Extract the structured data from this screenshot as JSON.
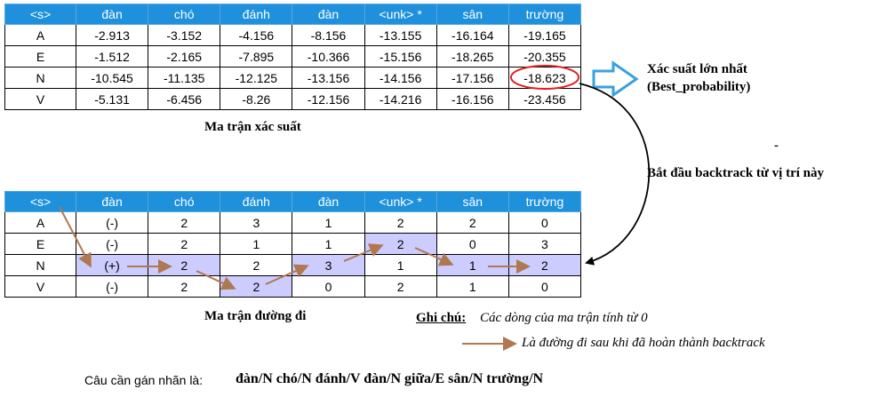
{
  "prob_matrix": {
    "headers": [
      "<s>",
      "đàn",
      "chó",
      "đánh",
      "đàn",
      "<unk> *",
      "sân",
      "trường"
    ],
    "rows": [
      [
        "A",
        "-2.913",
        "-3.152",
        "-4.156",
        "-8.156",
        "-13.155",
        "-16.164",
        "-19.165"
      ],
      [
        "E",
        "-1.512",
        "-2.165",
        "-7.895",
        "-10.366",
        "-15.156",
        "-18.265",
        "-20.355"
      ],
      [
        "N",
        "-10.545",
        "-11.135",
        "-12.125",
        "-13.156",
        "-14.156",
        "-17.156",
        "-18.623"
      ],
      [
        "V",
        "-5.131",
        "-6.456",
        "-8.26",
        "-12.156",
        "-14.216",
        "-16.156",
        "-23.456"
      ]
    ],
    "caption": "Ma trận xác suất"
  },
  "path_matrix": {
    "headers": [
      "<s>",
      "đàn",
      "chó",
      "đánh",
      "đàn",
      "<unk> *",
      "sân",
      "trường"
    ],
    "rows": [
      [
        "A",
        "(-)",
        "2",
        "3",
        "1",
        "2",
        "2",
        "0"
      ],
      [
        "E",
        "(-)",
        "2",
        "1",
        "1",
        "2",
        "0",
        "3"
      ],
      [
        "N",
        "(+)",
        "2",
        "2",
        "3",
        "1",
        "1",
        "2"
      ],
      [
        "V",
        "(-)",
        "2",
        "2",
        "0",
        "2",
        "1",
        "0"
      ]
    ],
    "caption": "Ma trận đường đi"
  },
  "annotations": {
    "best_prob_line1": "Xác suất lớn nhất",
    "best_prob_line2": "(Best_probability)",
    "dash": "-",
    "backtrack_start": "Bắt đầu backtrack từ vị trí này"
  },
  "note": {
    "title": "Ghi chú:",
    "line1": "Các dòng của ma trận tính từ 0",
    "line2": "Là đường đi sau khi đã hoàn thành backtrack"
  },
  "sentence": {
    "label": "Câu cần gán nhãn là:",
    "value": "đàn/N chó/N đánh/V đàn/N giữa/E sân/N trường/N"
  },
  "colors": {
    "header_bg": "#1e90dc",
    "highlight": "#ccccff",
    "arrow": "#b07850",
    "circle": "#e02020",
    "outline_arrow": "#3aa0e0"
  }
}
